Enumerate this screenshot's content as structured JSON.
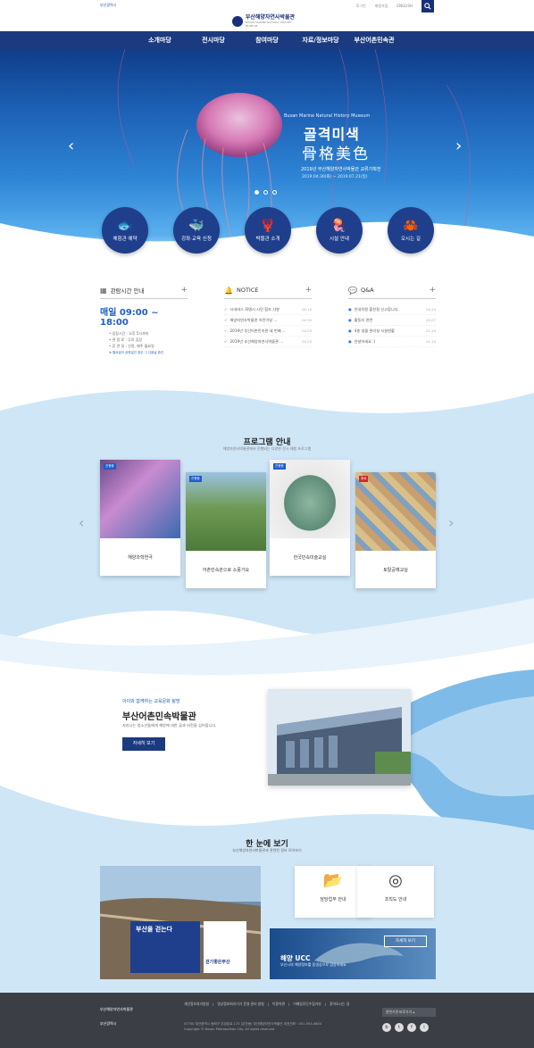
{
  "util": {
    "city": "부산광역시",
    "links": [
      "로그인",
      "회원가입",
      "ENGLISH"
    ]
  },
  "logo": {
    "name": "부산해양자연사박물관",
    "sub": "BUSAN MARINE NATURAL HISTORY MUSEUM"
  },
  "gnb": [
    "소개마당",
    "전시마당",
    "참여마당",
    "자료/정보마당",
    "부산어촌민속관"
  ],
  "hero": {
    "sub_en": "Busan Marine Natural History Museum",
    "title1": "골격미색",
    "title2": "骨格美色",
    "desc": "2019년 부산해양자연사박물관 교류기획전",
    "date": "2019.04.30(화) ~ 2019.07.21(일)"
  },
  "quick": [
    {
      "icon": "fish-icon",
      "glyph": "🐟",
      "label": "체험관 예약"
    },
    {
      "icon": "whale-icon",
      "glyph": "🐳",
      "label": "강좌·교육 신청"
    },
    {
      "icon": "lobster-icon",
      "glyph": "🦞",
      "label": "박물관 소개"
    },
    {
      "icon": "jellyfish-icon",
      "glyph": "🪼",
      "label": "시설 안내"
    },
    {
      "icon": "crab-icon",
      "glyph": "🦀",
      "label": "오시는 길"
    }
  ],
  "hours": {
    "title": "관람시간 안내",
    "time": "매일 09:00 ~ 18:00",
    "lines": [
      "• 입장시간 : 오후 5시까지",
      "• 관 람 료 : 무료 입장",
      "• 휴 관 일 : 신정, 매주 월요일"
    ],
    "note": "※ 월요일이 공휴일인 경우 그 다음날 휴관"
  },
  "notice": {
    "title": "NOTICE",
    "items": [
      {
        "t": "시내버스 화명시 시민 협조 사항",
        "d": "05.15"
      },
      {
        "t": "해양자연사박물관 어린이날 ...",
        "d": "04.30"
      },
      {
        "t": "2019년 부산어촌민속관 세 번째 ...",
        "d": "04.29"
      },
      {
        "t": "2019년 부산해양자연사박물관 ...",
        "d": "04.25"
      }
    ]
  },
  "qna": {
    "title": "Q&A",
    "items": [
      {
        "t": "안내직원 불친절 신고합니다",
        "d": "04.24"
      },
      {
        "t": "활동지 관련",
        "d": "02.07"
      },
      {
        "t": "4층 생물 관리실 시설현황",
        "d": "01.29"
      },
      {
        "t": "안녕하세요 :)",
        "d": "01.19"
      }
    ]
  },
  "program": {
    "title": "프로그램 안내",
    "sub": "해양자연사박물관에서 진행되는 다양한 전시·체험 프로그램",
    "cards": [
      {
        "tag": "진행중",
        "label": "해양과학연극"
      },
      {
        "tag": "진행중",
        "label": "어촌민속관으로 소풍가요"
      },
      {
        "tag": "진행중",
        "label": "한국민속미술교실"
      },
      {
        "tag": "종료",
        "label": "토탈공예교실"
      }
    ]
  },
  "museum": {
    "small": "아이와 함께하는 교육문화 탐방",
    "title": "부산어촌민속박물관",
    "desc": "자라나는 청소년들에게 해양에 대한 꿈과 비전을 심어줍니다.",
    "btn": "자세히 보기"
  },
  "glance": {
    "title": "한 눈에 보기",
    "sub": "부산해양자연사박물관과 관련된 정보 모아보기",
    "photo_text": "부산을 걷는다",
    "photo_badge": "걷기좋은부산",
    "cards": [
      "담당업무 안내",
      "조직도 안내"
    ],
    "ucc_title": "해양 UCC",
    "ucc_desc": "부산시의 해양정보를 동영상으로 감상하세요",
    "ucc_btn": "자세히 보기"
  },
  "footer": {
    "links": [
      "개인정보처리방침",
      "영상정보처리기기 운영·관리 방침",
      "이용약관",
      "이메일무단수집거부",
      "찾아오시는 길"
    ],
    "addr1": "47700 부산광역시 동래구 우장춘로 175 (온천동) 부산해양자연사박물관 대표전화 : 051-553-4844",
    "addr2": "Copyright © Busan Metropolitan City. All rights reserved.",
    "logo1": "부산해양자연사박물관",
    "logo2": "부산광역시",
    "sel": "관련기관 바로가기"
  },
  "colors": {
    "navy": "#1c3a7f",
    "accent": "#1f5cc9",
    "sky": "#cfe6f7"
  }
}
